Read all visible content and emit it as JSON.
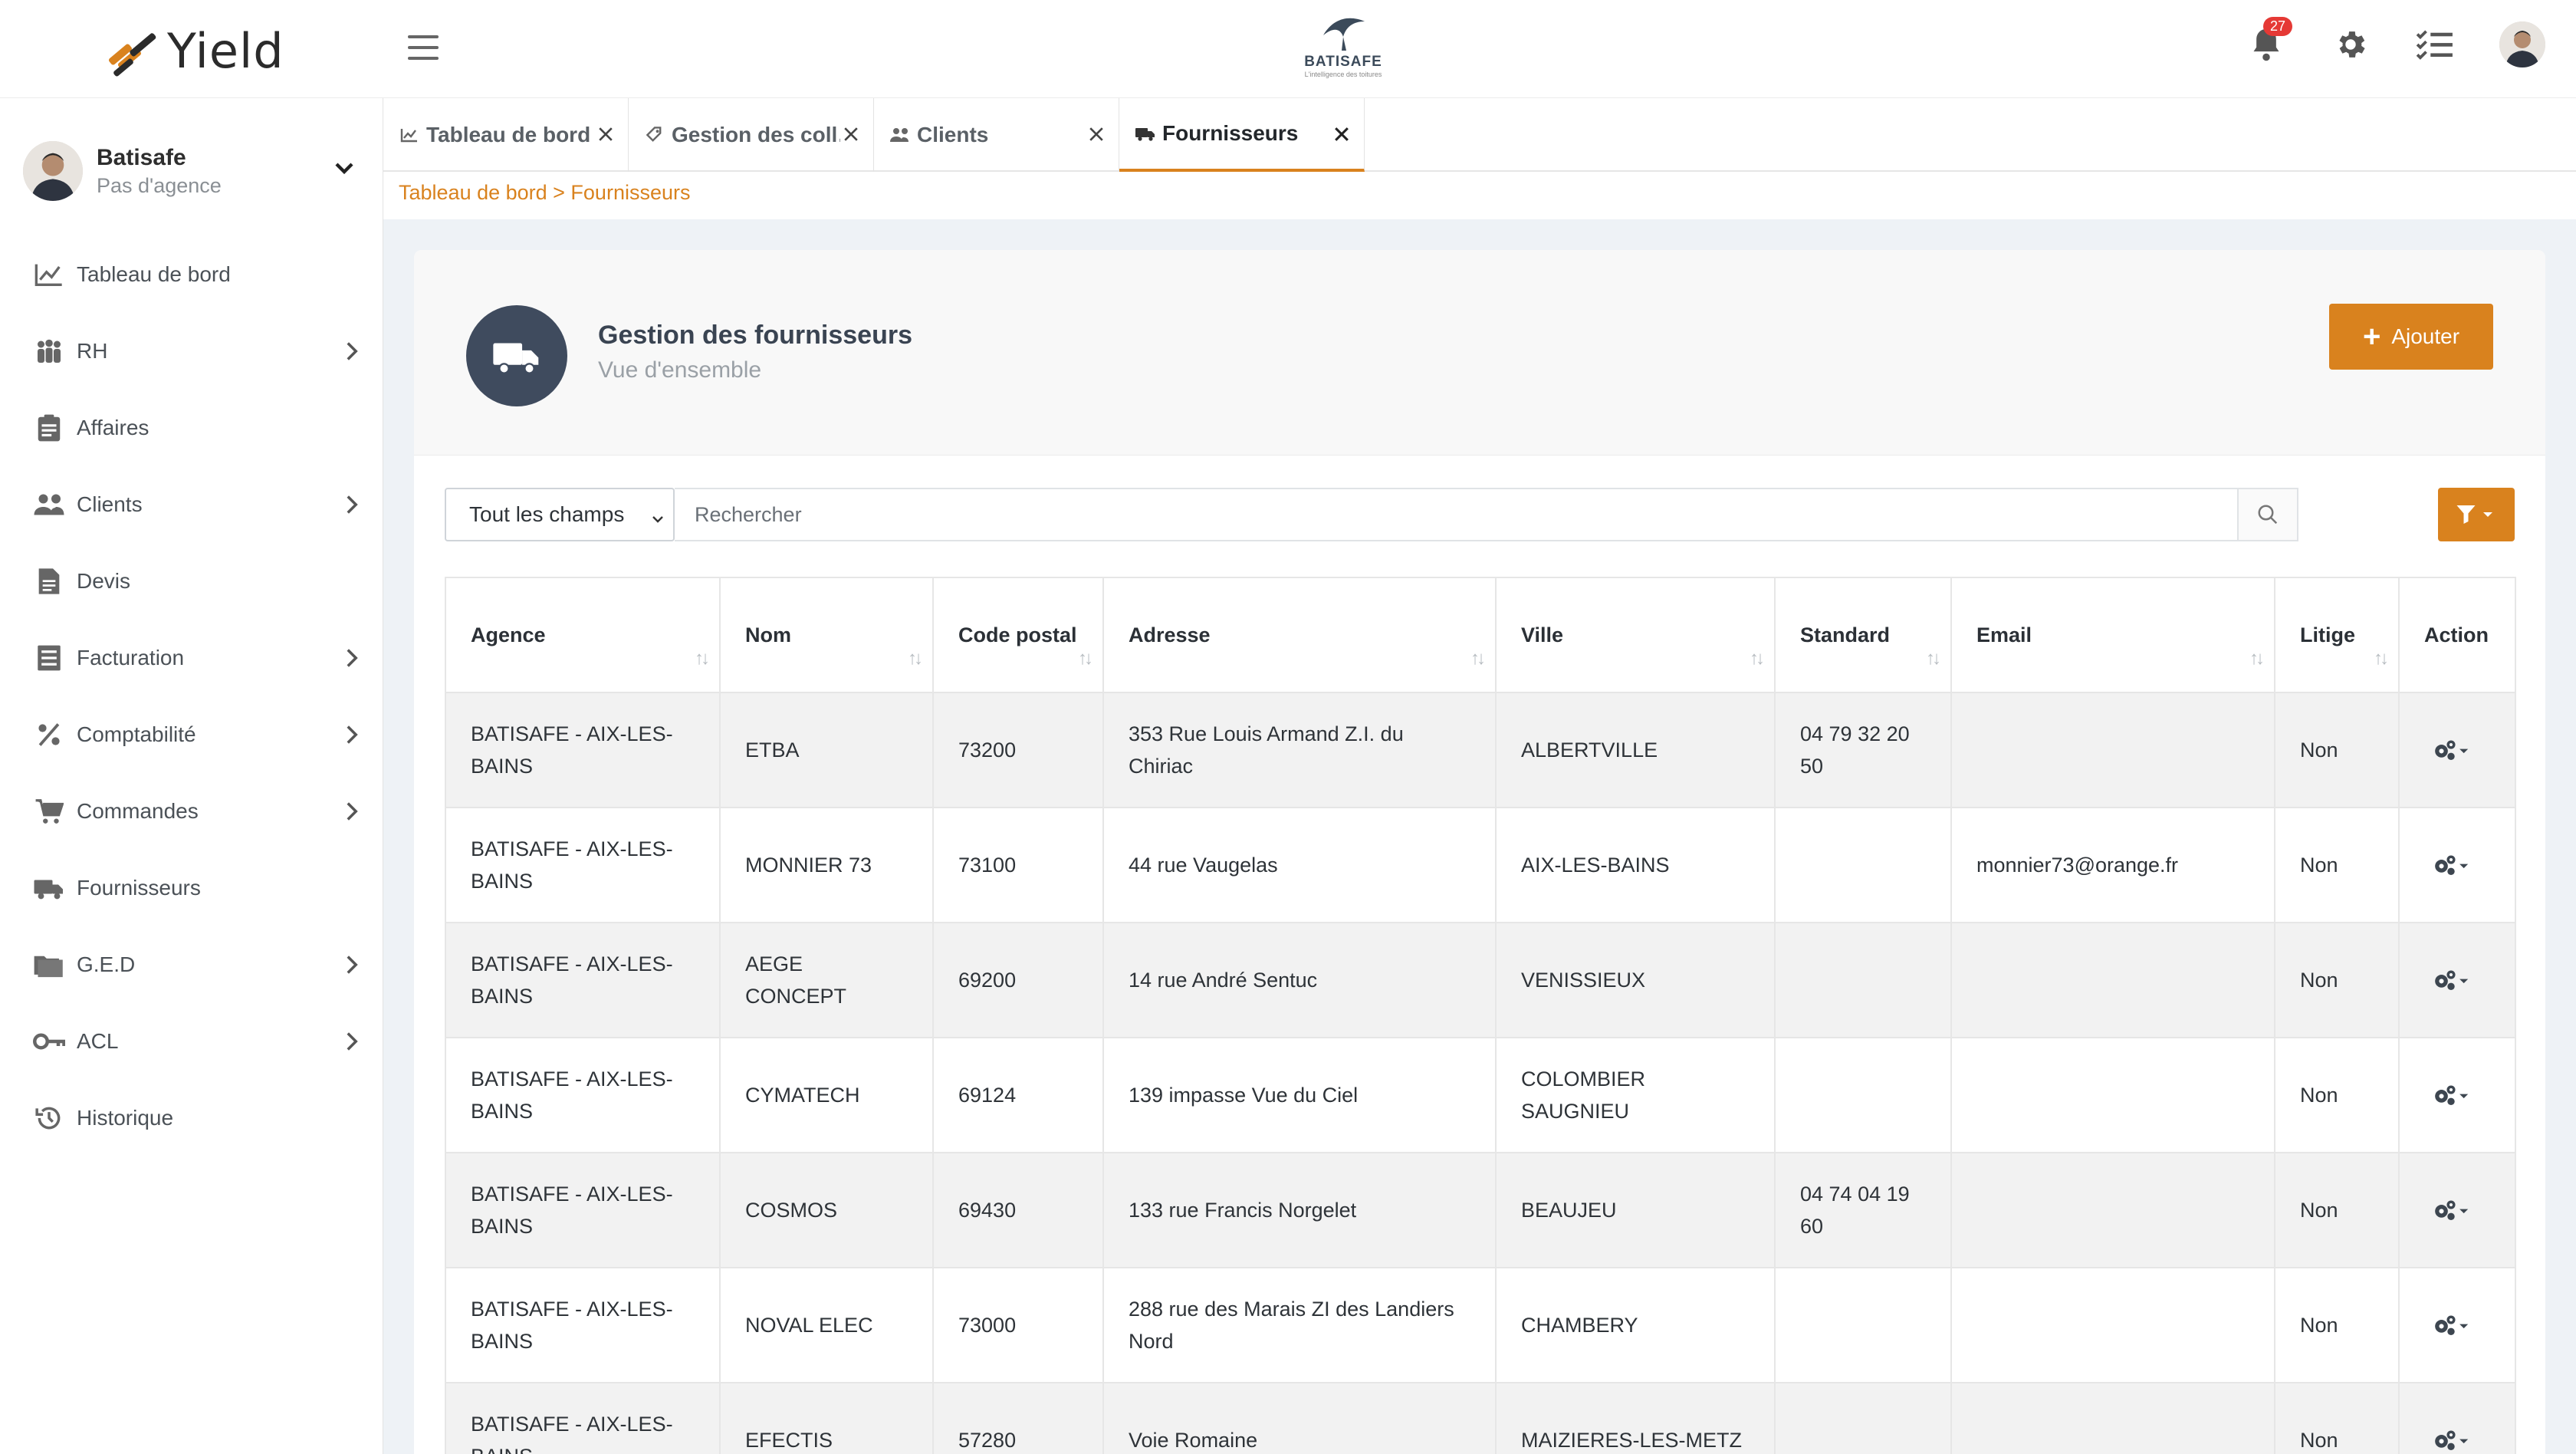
{
  "app": {
    "logo_text": "Yield",
    "brand_name": "BATISAFE",
    "brand_tagline": "L'intelligence des toitures",
    "notifications_count": "27"
  },
  "user": {
    "name": "Batisafe",
    "agency": "Pas d'agence"
  },
  "sidebar": {
    "items": [
      {
        "label": "Tableau de bord",
        "icon": "chart-line-icon",
        "has_submenu": false
      },
      {
        "label": "RH",
        "icon": "people-group-icon",
        "has_submenu": true
      },
      {
        "label": "Affaires",
        "icon": "clipboard-icon",
        "has_submenu": false
      },
      {
        "label": "Clients",
        "icon": "users-icon",
        "has_submenu": true
      },
      {
        "label": "Devis",
        "icon": "document-icon",
        "has_submenu": false
      },
      {
        "label": "Facturation",
        "icon": "list-icon",
        "has_submenu": true
      },
      {
        "label": "Comptabilité",
        "icon": "percent-icon",
        "has_submenu": true
      },
      {
        "label": "Commandes",
        "icon": "cart-icon",
        "has_submenu": true
      },
      {
        "label": "Fournisseurs",
        "icon": "truck-icon",
        "has_submenu": false
      },
      {
        "label": "G.E.D",
        "icon": "folder-icon",
        "has_submenu": true
      },
      {
        "label": "ACL",
        "icon": "key-icon",
        "has_submenu": true
      },
      {
        "label": "Historique",
        "icon": "history-icon",
        "has_submenu": false
      }
    ]
  },
  "tabs": [
    {
      "label": "Tableau de bord",
      "icon": "chart-line-icon",
      "active": false
    },
    {
      "label": "Gestion des coll…",
      "icon": "tag-icon",
      "active": false
    },
    {
      "label": "Clients",
      "icon": "users-icon",
      "active": false
    },
    {
      "label": "Fournisseurs",
      "icon": "truck-icon",
      "active": true
    }
  ],
  "breadcrumb": "Tableau de bord > Fournisseurs",
  "page": {
    "title": "Gestion des fournisseurs",
    "subtitle": "Vue d'ensemble",
    "add_label": "Ajouter"
  },
  "search": {
    "field_select": "Tout les champs",
    "placeholder": "Rechercher"
  },
  "colors": {
    "accent": "#d9821e",
    "header_icon_bg": "#3f4b5e",
    "badge": "#e53935"
  },
  "table": {
    "columns": [
      "Agence",
      "Nom",
      "Code postal",
      "Adresse",
      "Ville",
      "Standard",
      "Email",
      "Litige",
      "Action"
    ],
    "rows": [
      {
        "agence": "BATISAFE - AIX-LES-BAINS",
        "nom": "ETBA",
        "cp": "73200",
        "adresse": "353 Rue Louis Armand Z.I. du Chiriac",
        "ville": "ALBERTVILLE",
        "standard": "04 79 32 20 50",
        "email": "",
        "litige": "Non"
      },
      {
        "agence": "BATISAFE - AIX-LES-BAINS",
        "nom": "MONNIER 73",
        "cp": "73100",
        "adresse": "44 rue Vaugelas",
        "ville": "AIX-LES-BAINS",
        "standard": "",
        "email": "monnier73@orange.fr",
        "litige": "Non"
      },
      {
        "agence": "BATISAFE - AIX-LES-BAINS",
        "nom": "AEGE CONCEPT",
        "cp": "69200",
        "adresse": "14 rue André Sentuc",
        "ville": "VENISSIEUX",
        "standard": "",
        "email": "",
        "litige": "Non"
      },
      {
        "agence": "BATISAFE - AIX-LES-BAINS",
        "nom": "CYMATECH",
        "cp": "69124",
        "adresse": "139 impasse Vue du Ciel",
        "ville": "COLOMBIER SAUGNIEU",
        "standard": "",
        "email": "",
        "litige": "Non"
      },
      {
        "agence": "BATISAFE - AIX-LES-BAINS",
        "nom": "COSMOS",
        "cp": "69430",
        "adresse": "133 rue Francis Norgelet",
        "ville": "BEAUJEU",
        "standard": "04 74 04 19 60",
        "email": "",
        "litige": "Non"
      },
      {
        "agence": "BATISAFE - AIX-LES-BAINS",
        "nom": "NOVAL ELEC",
        "cp": "73000",
        "adresse": "288 rue des Marais ZI des Landiers Nord",
        "ville": "CHAMBERY",
        "standard": "",
        "email": "",
        "litige": "Non"
      },
      {
        "agence": "BATISAFE - AIX-LES-BAINS",
        "nom": "EFECTIS",
        "cp": "57280",
        "adresse": "Voie Romaine",
        "ville": "MAIZIERES-LES-METZ",
        "standard": "",
        "email": "",
        "litige": "Non"
      }
    ]
  }
}
